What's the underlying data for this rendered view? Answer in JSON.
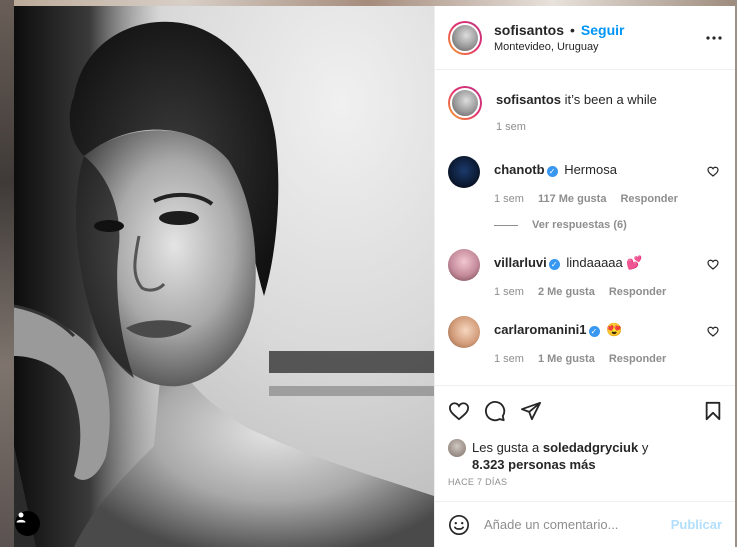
{
  "post": {
    "username": "sofisantos",
    "follow_label": "Seguir",
    "location": "Montevideo, Uruguay",
    "caption": {
      "username": "sofisantos",
      "text": "it’s been a while",
      "time": "1 sem"
    }
  },
  "comments": [
    {
      "username": "chanotb",
      "verified": true,
      "text": "Hermosa",
      "time": "1 sem",
      "likes": "117 Me gusta",
      "reply_label": "Responder",
      "view_replies": "Ver respuestas (6)"
    },
    {
      "username": "villarluvi",
      "verified": true,
      "text": "lindaaaaa",
      "emoji": "💕",
      "time": "1 sem",
      "likes": "2 Me gusta",
      "reply_label": "Responder"
    },
    {
      "username": "carlaromanini1",
      "verified": true,
      "emoji": "😍",
      "time": "1 sem",
      "likes": "1 Me gusta",
      "reply_label": "Responder"
    }
  ],
  "likes_summary": {
    "prefix": "Les gusta a",
    "user": "soledadgryciuk",
    "connector": "y",
    "others": "8.323 personas más"
  },
  "time_ago": "HACE 7 DÍAS",
  "comment_box": {
    "placeholder": "Añade un comentario...",
    "publish_label": "Publicar"
  },
  "colors": {
    "accent": "#0095f6",
    "publish_disabled": "#b2dffc",
    "verified": "#3897f0",
    "meta_gray": "#8e8e8e"
  },
  "icons": {
    "like": "heart-icon",
    "comment": "comment-bubble-icon",
    "share": "paper-plane-icon",
    "save": "bookmark-icon",
    "more": "more-options-icon",
    "emoji": "emoji-smile-icon",
    "tag": "user-tag-icon"
  }
}
